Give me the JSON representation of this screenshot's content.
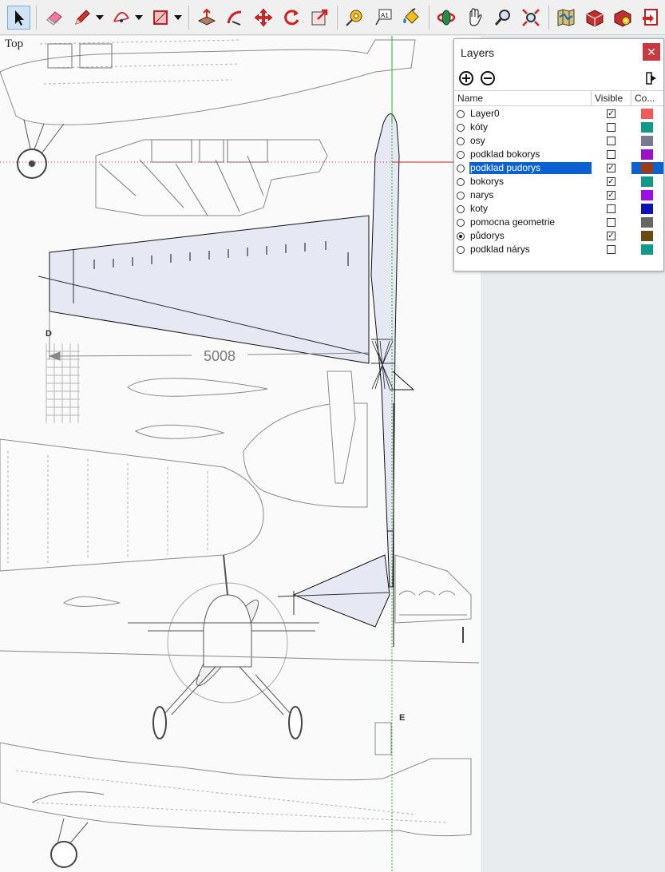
{
  "toolbar": {
    "tools": [
      "select",
      "eraser",
      "pencil",
      "arc",
      "rectangle",
      "push-pull",
      "follow-me",
      "move",
      "rotate",
      "scale",
      "tape-measure",
      "text",
      "paint-bucket",
      "orbit",
      "pan",
      "zoom",
      "zoom-extents",
      "3d-warehouse",
      "extension-warehouse",
      "layout",
      "send-to-layout"
    ],
    "active_tool": "select"
  },
  "viewport": {
    "view_name": "Top",
    "dimension_text": "5008",
    "drawing_markers": [
      "D",
      "E"
    ]
  },
  "layers_panel": {
    "title": "Layers",
    "close_symbol": "✕",
    "columns": [
      "Name",
      "Visible",
      "Co..."
    ],
    "rows": [
      {
        "name": "Layer0",
        "visible": true,
        "active": false,
        "color": "#f25a5a",
        "selected": false
      },
      {
        "name": "kóty",
        "visible": false,
        "active": false,
        "color": "#109b88",
        "selected": false
      },
      {
        "name": "osy",
        "visible": false,
        "active": false,
        "color": "#7a7a8e",
        "selected": false
      },
      {
        "name": "podklad bokorys",
        "visible": false,
        "active": false,
        "color": "#9b10c8",
        "selected": false
      },
      {
        "name": "podklad pudorys",
        "visible": true,
        "active": false,
        "color": "#9c3c10",
        "selected": true
      },
      {
        "name": "bokorys",
        "visible": true,
        "active": false,
        "color": "#109b88",
        "selected": false
      },
      {
        "name": "narys",
        "visible": true,
        "active": false,
        "color": "#9b10e8",
        "selected": false
      },
      {
        "name": "koty",
        "visible": false,
        "active": false,
        "color": "#1010b8",
        "selected": false
      },
      {
        "name": "pomocna geometrie",
        "visible": false,
        "active": false,
        "color": "#666666",
        "selected": false
      },
      {
        "name": "půdorys",
        "visible": true,
        "active": true,
        "color": "#6a4a10",
        "selected": false
      },
      {
        "name": "podklad nárys",
        "visible": false,
        "active": false,
        "color": "#109b88",
        "selected": false
      }
    ]
  }
}
